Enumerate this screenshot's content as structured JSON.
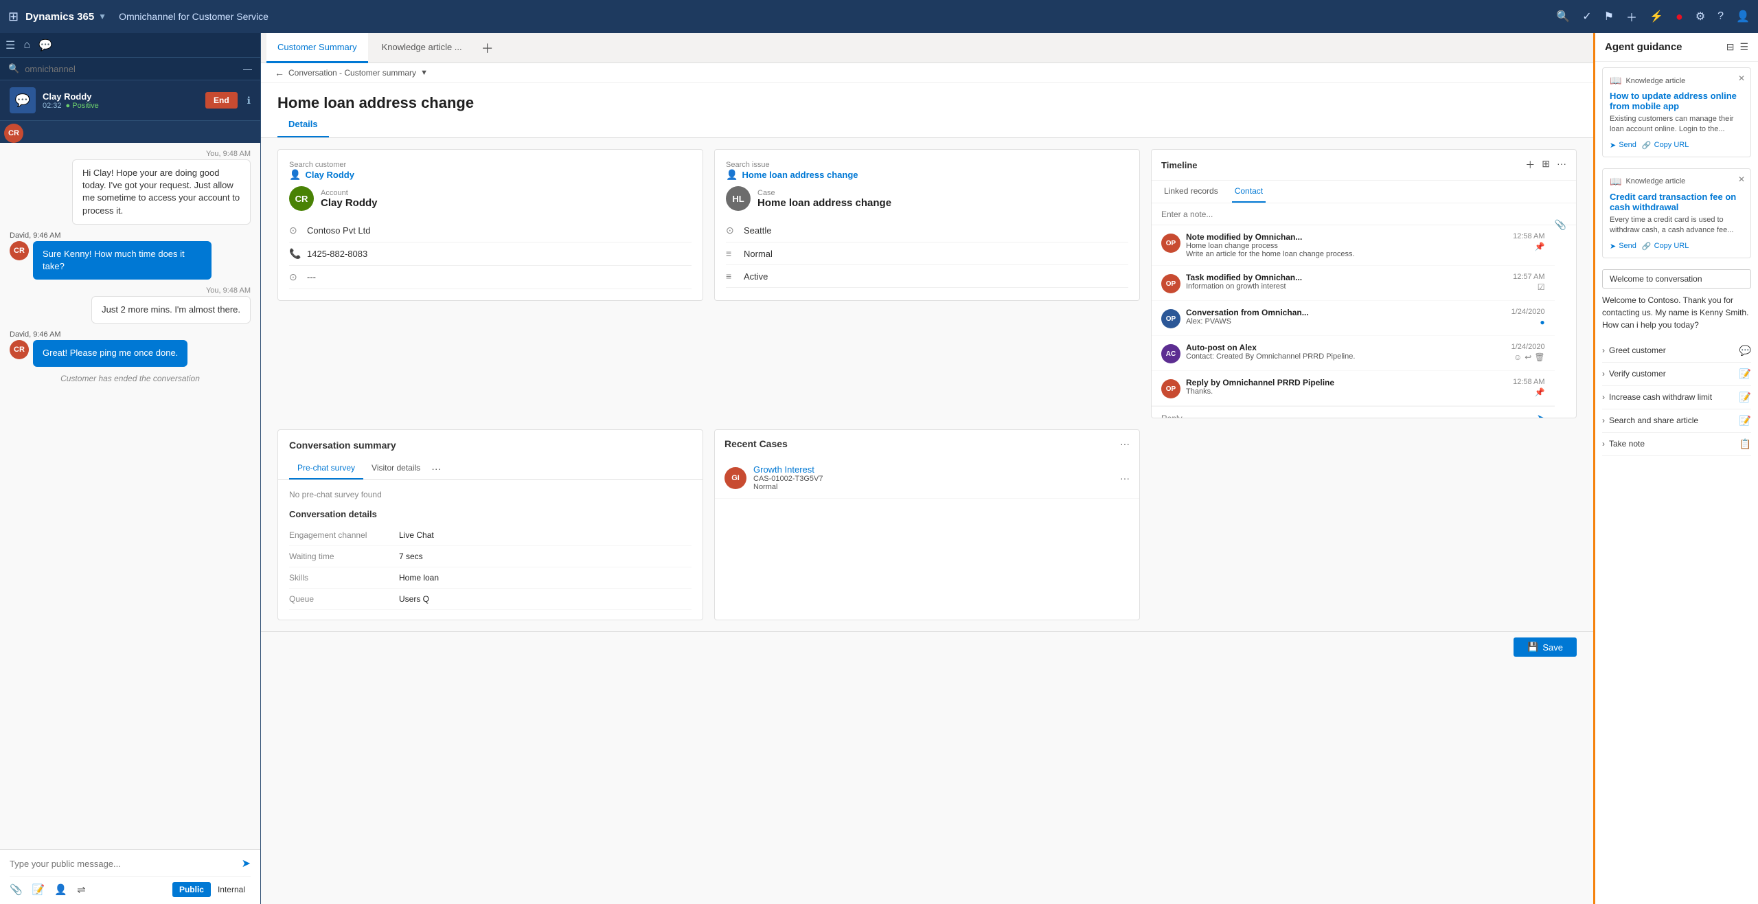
{
  "app": {
    "name": "Dynamics 365",
    "subtitle": "Omnichannel for Customer Service"
  },
  "topnav": {
    "icons": [
      "search",
      "checkmark-circle",
      "flag",
      "plus",
      "filter",
      "notification",
      "settings",
      "help",
      "person"
    ]
  },
  "sidebar": {
    "search_placeholder": "omnichannel",
    "chat_item": {
      "name": "Clay Roddy",
      "time": "02:32",
      "sentiment": "Positive",
      "end_label": "End"
    }
  },
  "chat": {
    "messages": [
      {
        "type": "right",
        "timestamp": "You, 9:48 AM",
        "text": "Hi Clay! Hope your are doing good today. I've got your request. Just allow me sometime to access your account to process it."
      },
      {
        "type": "left",
        "sender": "David, 9:46 AM",
        "text": "Sure Kenny! How much time does it take?"
      },
      {
        "type": "right",
        "timestamp": "You, 9:48 AM",
        "text": "Just 2 more mins. I'm almost there."
      },
      {
        "type": "left",
        "sender": "David, 9:46 AM",
        "text": "Great! Please ping me once done."
      }
    ],
    "ended_text": "Customer has ended the conversation",
    "input_placeholder": "Type your public message...",
    "public_label": "Public",
    "internal_label": "Internal"
  },
  "tabs": [
    {
      "label": "Customer Summary",
      "active": true
    },
    {
      "label": "Knowledge article ...",
      "active": false
    }
  ],
  "content": {
    "title": "Home loan address change",
    "breadcrumb": "Conversation - Customer summary",
    "sub_tabs": [
      "Details"
    ],
    "active_sub_tab": "Details"
  },
  "customer_card": {
    "label": "Search customer",
    "customer_name": "Clay Roddy",
    "avatar_initials": "CR",
    "account": "Account",
    "account_name": "Clay Roddy",
    "company": "Contoso Pvt Ltd",
    "phone": "1425-882-8083",
    "extra": "---"
  },
  "issue_card": {
    "label": "Search issue",
    "issue_name": "Home loan address change",
    "case_label": "Case",
    "case_name": "Home loan address change",
    "location": "Seattle",
    "priority": "Normal",
    "status": "Active"
  },
  "timeline": {
    "title": "Timeline",
    "linked_tabs": [
      "Linked records",
      "Contact"
    ],
    "active_tab": "Contact",
    "note_placeholder": "Enter a note...",
    "items": [
      {
        "title": "Note modified by Omnichan...",
        "subtitle": "Home loan change process",
        "detail": "Write an article for the home loan change process.",
        "time": "12:58 AM",
        "avatar": "OP"
      },
      {
        "title": "Task modified by Omnichan...",
        "subtitle": "Information on growth interest",
        "detail": "",
        "time": "12:57 AM",
        "avatar": "OP"
      },
      {
        "title": "Conversation from Omnichan...",
        "subtitle": "Alex: PVAWS",
        "detail": "",
        "time": "1/24/2020",
        "avatar": "OP",
        "type": "blue"
      },
      {
        "title": "Auto-post on Alex",
        "subtitle": "Contact: Created By Omnichannel PRRD Pipeline.",
        "detail": "",
        "time": "1/24/2020",
        "avatar": "AC",
        "type": "blue"
      },
      {
        "title": "Reply by Omnichannel PRRD Pipeline",
        "subtitle": "Thanks.",
        "detail": "",
        "time": "12:58 AM",
        "avatar": "OP"
      }
    ],
    "reply_placeholder": "Reply..."
  },
  "conversation_summary": {
    "title": "Conversation summary",
    "sub_tabs": [
      "Pre-chat survey",
      "Visitor details"
    ],
    "active_tab": "Pre-chat survey",
    "no_survey": "No pre-chat survey found",
    "details_title": "Conversation details",
    "fields": [
      {
        "label": "Engagement channel",
        "value": "Live Chat"
      },
      {
        "label": "Waiting time",
        "value": "7 secs"
      },
      {
        "label": "Skills",
        "value": "Home loan"
      },
      {
        "label": "Queue",
        "value": "Users Q"
      }
    ]
  },
  "recent_cases": {
    "title": "Recent Cases",
    "items": [
      {
        "avatar": "GI",
        "name": "Growth Interest",
        "id": "CAS-01002-T3G5V7",
        "status": "Normal"
      }
    ]
  },
  "agent_guidance": {
    "title": "Agent guidance",
    "knowledge_cards": [
      {
        "type": "Knowledge article",
        "title": "How to update address online from mobile app",
        "body": "Existing customers can manage their loan account online. Login to the...",
        "send_label": "Send",
        "copy_label": "Copy URL"
      },
      {
        "type": "Knowledge article",
        "title": "Credit card transaction fee on cash withdrawal",
        "body": "Every time a credit card is used to withdraw cash, a cash advance fee...",
        "send_label": "Send",
        "copy_label": "Copy URL"
      }
    ],
    "script_dropdown": "Welcome to conversation",
    "script_welcome": "Welcome to Contoso. Thank you for contacting us. My name is Kenny Smith. How can i help you today?",
    "steps": [
      {
        "label": "Greet customer",
        "icon": "chat"
      },
      {
        "label": "Verify customer",
        "icon": "edit"
      },
      {
        "label": "Increase cash withdraw limit",
        "icon": "edit"
      },
      {
        "label": "Search and share article",
        "icon": "edit"
      },
      {
        "label": "Take note",
        "icon": "list"
      }
    ]
  }
}
